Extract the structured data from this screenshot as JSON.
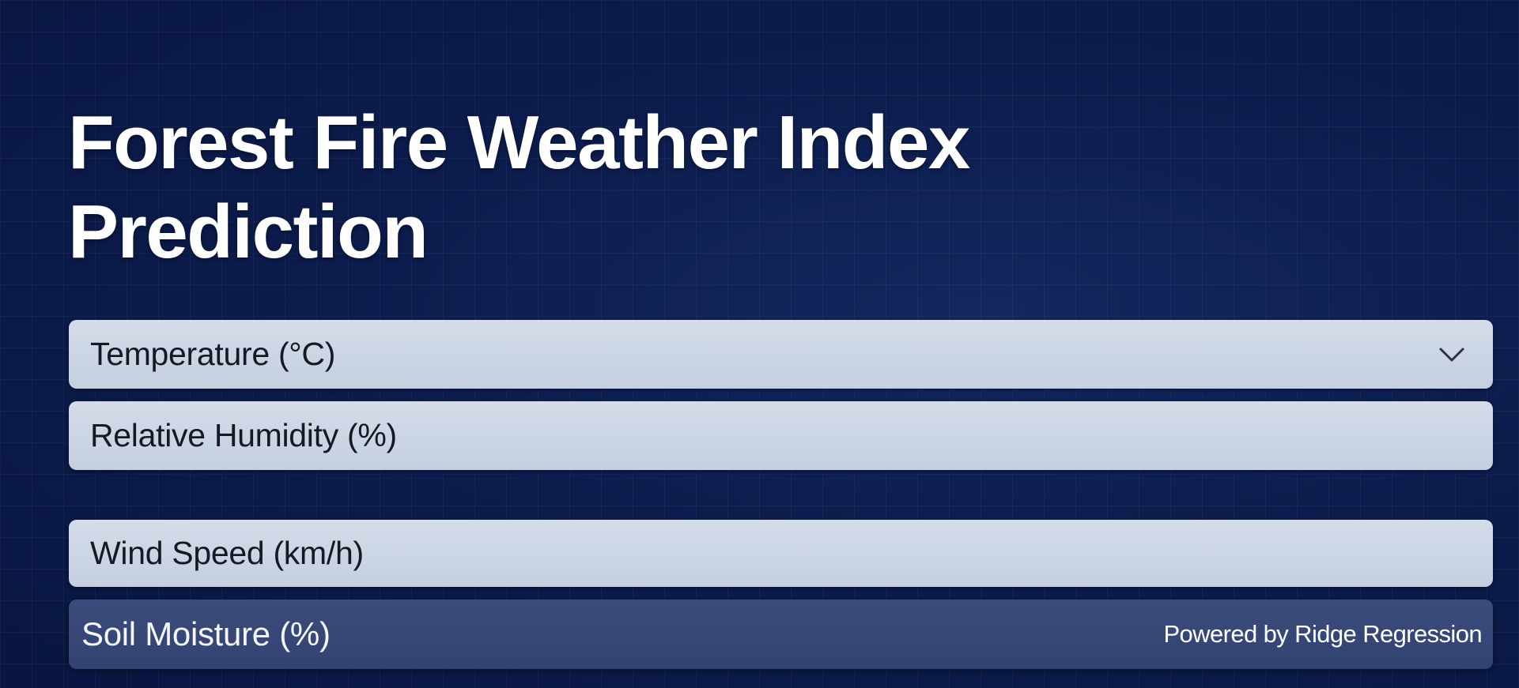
{
  "page": {
    "title": "Forest Fire Weather Index Prediction"
  },
  "form": {
    "fields": [
      {
        "label": "Temperature (°C)",
        "control": "select",
        "icon": "chevron-down-icon"
      },
      {
        "label": "Relative Humidity (%)",
        "control": "input"
      },
      {
        "label": "Wind Speed (km/h)",
        "control": "input"
      },
      {
        "label": "Soil Moisture (%)",
        "control": "input"
      }
    ]
  },
  "footer": {
    "powered_by": "Powered by Ridge Regression"
  },
  "colors": {
    "background": "#0b1a47",
    "field_background": "#ccd5e4",
    "field_text": "#141923",
    "active_field_background": "#374877",
    "title_text": "#ffffff"
  }
}
